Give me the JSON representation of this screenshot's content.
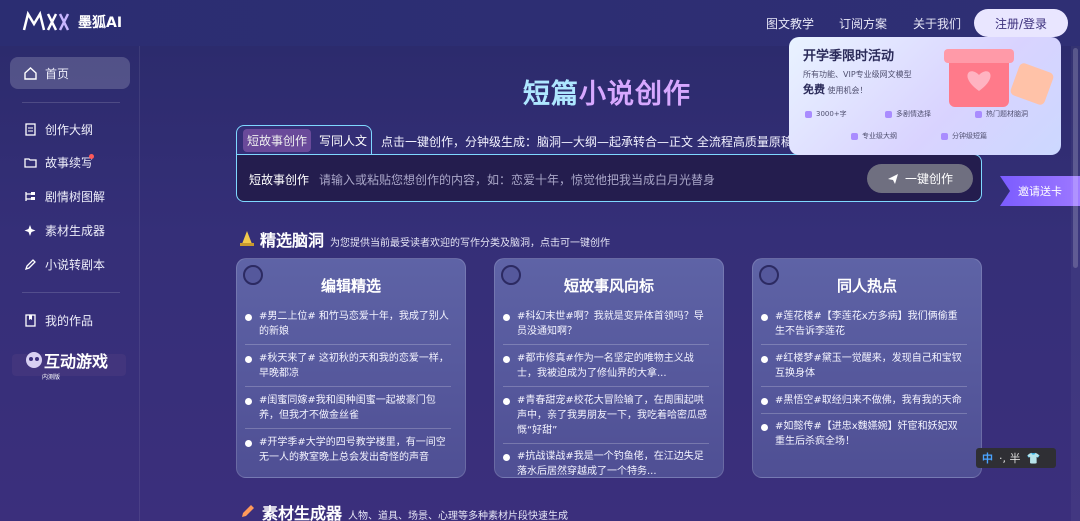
{
  "header": {
    "brand_name": "墨狐AI",
    "nav": [
      "图文教学",
      "订阅方案",
      "关于我们"
    ],
    "login_label": "注册/登录"
  },
  "sidebar": {
    "items": [
      {
        "label": "首页",
        "icon": "home-icon"
      },
      {
        "label": "创作大纲",
        "icon": "document-icon"
      },
      {
        "label": "故事续写",
        "icon": "folder-icon"
      },
      {
        "label": "剧情树图解",
        "icon": "tree-icon"
      },
      {
        "label": "素材生成器",
        "icon": "sparkle-icon"
      },
      {
        "label": "小说转剧本",
        "icon": "pen-icon"
      },
      {
        "label": "我的作品",
        "icon": "book-icon"
      }
    ],
    "game_badge": {
      "text": "互动游戏",
      "small": "内测版"
    }
  },
  "main": {
    "title_part1": "短篇",
    "title_part2": "小说创作",
    "tabs": [
      "短故事创作",
      "写同人文"
    ],
    "tagline": "点击一键创作，分钟级生成：脑洞—大纲—起承转合—正文 全流程高质量原稿",
    "input": {
      "label": "短故事创作",
      "placeholder": "请输入或粘贴您想创作的内容，如：恋爱十年，惊觉他把我当成白月光替身",
      "button": "一键创作"
    },
    "section1": {
      "title": "精选脑洞",
      "subtitle": "为您提供当前最受读者欢迎的写作分类及脑洞，点击可一键创作"
    },
    "cards": [
      {
        "title": "编辑精选",
        "items": [
          "#男二上位# 和竹马恋爱十年，我成了别人的新娘",
          "#秋天来了# 这初秋的天和我的恋爱一样，早晚都凉",
          "#闺蜜同嫁#我和闺种闺蜜一起被豪门包养，但我才不做金丝雀",
          "#开学季#大学的四号教学楼里，有一间空无一人的教室晚上总会发出奇怪的声音"
        ]
      },
      {
        "title": "短故事风向标",
        "items": [
          "#科幻末世#啊？我就是变异体首领吗？导员没通知啊？",
          "#都市修真#作为一名坚定的唯物主义战士，我被迫成为了修仙界的大拿...",
          "#青春甜宠#校花大冒险输了，在周围起哄声中，亲了我男朋友一下，我吃着哈密瓜感慨“好甜”",
          "#抗战谍战#我是一个钓鱼佬，在江边失足落水后居然穿越成了一个特务..."
        ]
      },
      {
        "title": "同人热点",
        "items": [
          "#莲花楼#【李莲花x方多病】我们俩偷重生不告诉李莲花",
          "#红楼梦#黛玉一觉醒来，发现自己和宝钗互换身体",
          "#黑悟空#取经归来不做佛，我有我的天命",
          "#如懿传#【进忠x魏嬿婉】奸宦和妖妃双重生后杀疯全场！"
        ]
      }
    ],
    "section2": {
      "title": "素材生成器",
      "subtitle": "人物、道具、场景、心理等多种素材片段快速生成"
    }
  },
  "promo": {
    "title": "开学季限时活动",
    "line1": "所有功能、VIP专业级网文模型",
    "free": "免费",
    "line2": "使用机会！",
    "features": [
      "3000+字",
      "多剧情选择",
      "热门题材脑洞",
      "专业级大纲",
      "分钟级短篇"
    ]
  },
  "invite_label": "邀请送卡",
  "ime": {
    "lang": "中",
    "extra": "·, 半"
  },
  "colors": {
    "accent_cyan": "#7fd8ff",
    "title_blue": "#aee7ff",
    "title_purple": "#d7a8ff",
    "bg": "#352f78"
  }
}
